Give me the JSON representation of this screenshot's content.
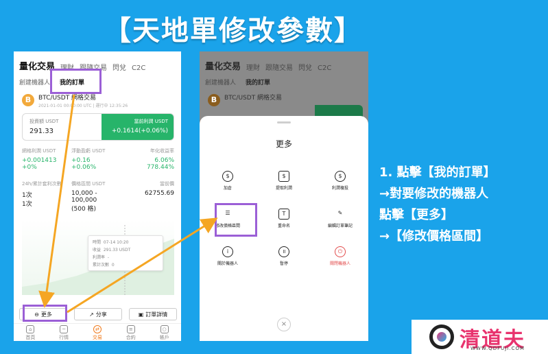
{
  "title": "【天地單修改參數】",
  "left_phone": {
    "tabs": [
      "量化交易",
      "理財",
      "跟隨交易",
      "閃兌",
      "C2C"
    ],
    "subtabs": [
      "創建機器人",
      "我的訂單"
    ],
    "coin_symbol": "B",
    "bot_name": "BTC/USDT 網格交易",
    "bot_meta": "2021-01-01 00:00:00 UTC | 運行中 12:35:26",
    "investment_label": "投資額 USDT",
    "investment_value": "291.33",
    "profit_label": "當前利潤 USDT",
    "profit_value": "+0.1614(+0.06%)",
    "stats": [
      {
        "label": "網格利潤 USDT",
        "value": "+0.001413",
        "value2": "+0%"
      },
      {
        "label": "浮動盈虧 USDT",
        "value": "+0.16",
        "value2": "+0.06%"
      },
      {
        "label": "年化收益率",
        "value": "6.06%",
        "value2": "778.44%"
      },
      {
        "label": "24h/累計套利次數",
        "value": "1次",
        "value2": "1次"
      },
      {
        "label": "價格區間 USDT",
        "value": "10,000 -",
        "value2": "100,000",
        "value3": "(500 格)"
      },
      {
        "label": "當前價",
        "value": "62755.69"
      }
    ],
    "tooltip": [
      {
        "label": "時間",
        "value": "07-14 10:20"
      },
      {
        "label": "收益",
        "value": "291.33 USDT"
      },
      {
        "label": "利潤率",
        "value": "-"
      },
      {
        "label": "累計次數",
        "value": "0"
      }
    ],
    "actions": [
      "更多",
      "分享",
      "訂單詳情"
    ],
    "nav": [
      "首頁",
      "行情",
      "交易",
      "合約",
      "帳戶"
    ]
  },
  "right_phone": {
    "tabs": [
      "量化交易",
      "理財",
      "跟隨交易",
      "閃兌",
      "C2C"
    ],
    "subtabs": [
      "創建機器人",
      "我的訂單"
    ],
    "bot_name": "BTC/USDT 網格交易",
    "sheet_title": "更多",
    "menu": [
      {
        "label": "加倉",
        "icon": "add-funds-icon"
      },
      {
        "label": "提取利潤",
        "icon": "withdraw-profit-icon"
      },
      {
        "label": "利潤複投",
        "icon": "reinvest-icon"
      },
      {
        "label": "修改價格區間",
        "icon": "sliders-icon"
      },
      {
        "label": "重命名",
        "icon": "rename-icon"
      },
      {
        "label": "編輯訂單筆記",
        "icon": "edit-icon"
      },
      {
        "label": "關於機器人",
        "icon": "info-icon"
      },
      {
        "label": "暫停",
        "icon": "pause-icon"
      },
      {
        "label": "關閉機器人",
        "icon": "power-icon"
      }
    ],
    "close_symbol": "×"
  },
  "instructions": [
    "1. 點擊【我的訂單】",
    "→對要修改的機器人",
    "點擊【更多】",
    "→【修改價格區間】"
  ],
  "watermark": {
    "text": "清道夫",
    "url": "WWW.QDFUJI.COM"
  },
  "colors": {
    "background": "#1aa3ea",
    "highlight": "#9b5fd6",
    "arrow": "#f5a623",
    "profit_green": "#27b46a",
    "danger": "#e24b4b"
  }
}
